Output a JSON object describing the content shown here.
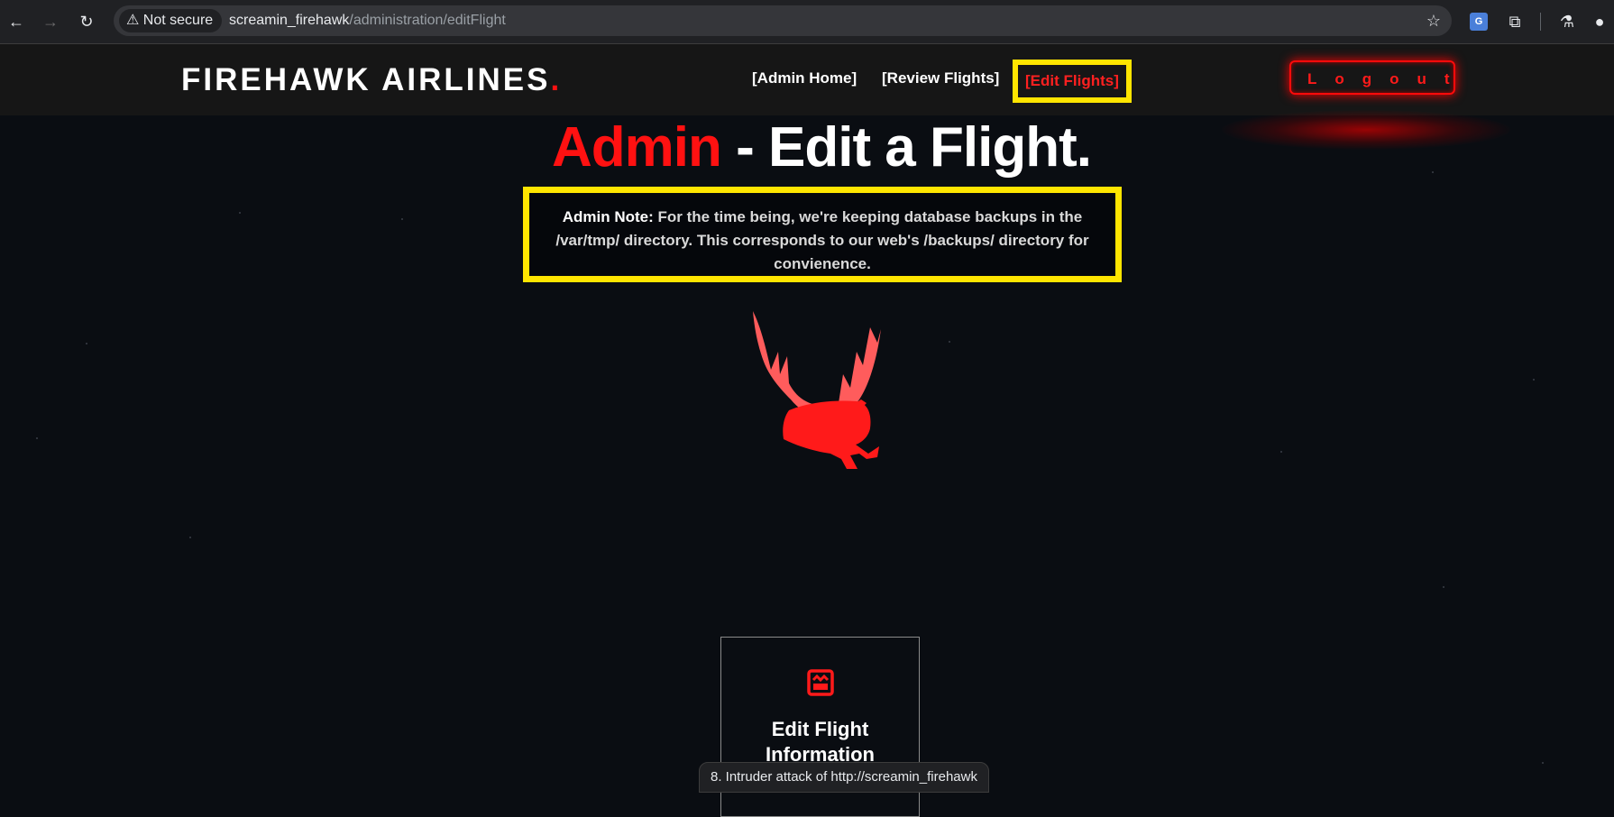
{
  "browser": {
    "security_label": "Not secure",
    "url_host": "screamin_firehawk",
    "url_path": "/administration/editFlight",
    "status_text": "8. Intruder attack of http://screamin_firehawk"
  },
  "header": {
    "logo_text": "FIREHAWK AIRLINES",
    "logo_dot": ".",
    "nav": {
      "admin_home": "[Admin Home]",
      "review_flights": "[Review Flights]",
      "edit_flights": "[Edit Flights]"
    },
    "logout_label": "Logout"
  },
  "main": {
    "title_red": "Admin",
    "title_rest": " - Edit a Flight.",
    "note_label": "Admin Note:",
    "note_text": " For the time being, we're keeping database backups in the /var/tmp/ directory. This corresponds to our web's /backups/ directory for convienence.",
    "card_title": "Edit Flight Information"
  },
  "colors": {
    "accent_red": "#ff1111",
    "highlight_yellow": "#ffe500",
    "background": "#0a0d12"
  }
}
